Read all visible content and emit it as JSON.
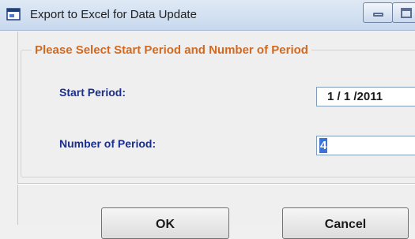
{
  "window": {
    "title": "Export to Excel for Data Update",
    "icon": "app-window-icon",
    "controls": [
      "minimize-icon",
      "maximize-icon"
    ]
  },
  "group": {
    "legend": "Please Select Start Period and Number of Period",
    "legend_color": "#d2691e"
  },
  "form": {
    "start_label": "Start Period:",
    "start_value": "1 / 1 /2011",
    "number_label": "Number of Period:",
    "number_value": "4",
    "label_color": "#1c2e8c"
  },
  "buttons": {
    "ok_label": "OK",
    "cancel_label": "Cancel"
  }
}
